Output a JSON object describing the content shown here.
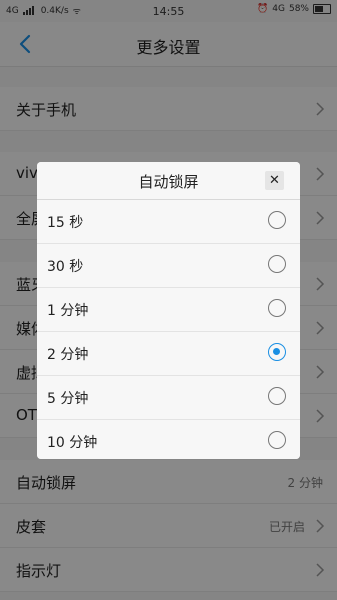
{
  "status_bar": {
    "left_network": "4G",
    "speed": "0.4K/s",
    "time": "14:55",
    "right_network": "4G",
    "battery": "58%"
  },
  "header": {
    "title": "更多设置"
  },
  "settings": [
    {
      "label": "关于手机",
      "value": ""
    },
    {
      "label": "vivo",
      "value": ""
    },
    {
      "label": "全屏",
      "value": ""
    },
    {
      "label": "蓝牙",
      "value": ""
    },
    {
      "label": "媒体",
      "value": ""
    },
    {
      "label": "虚拟",
      "value": ""
    },
    {
      "label": "OTG",
      "value": ""
    },
    {
      "label": "自动锁屏",
      "value": "2 分钟"
    },
    {
      "label": "皮套",
      "value": "已开启"
    },
    {
      "label": "指示灯",
      "value": ""
    }
  ],
  "dialog": {
    "title": "自动锁屏",
    "close": "✕",
    "options": [
      {
        "label": "15 秒",
        "selected": false
      },
      {
        "label": "30 秒",
        "selected": false
      },
      {
        "label": "1 分钟",
        "selected": false
      },
      {
        "label": "2 分钟",
        "selected": true
      },
      {
        "label": "5 分钟",
        "selected": false
      },
      {
        "label": "10 分钟",
        "selected": false
      }
    ]
  },
  "colors": {
    "accent": "#1a8fe3",
    "overlay": "rgba(0,0,0,0.45)"
  }
}
